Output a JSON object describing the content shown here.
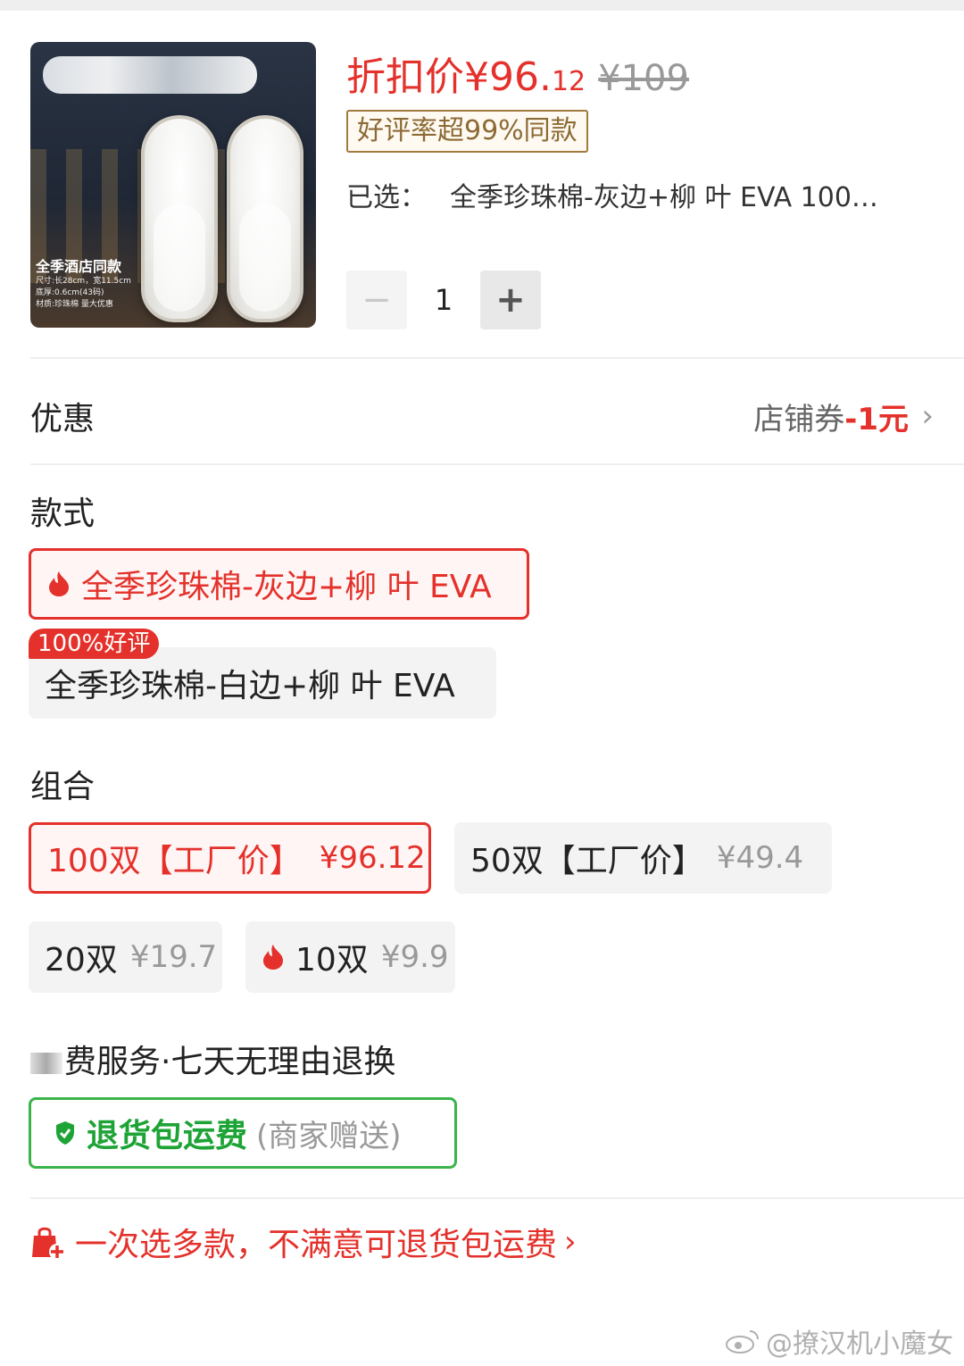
{
  "product": {
    "thumbnail_caption_title": "全季酒店同款",
    "thumbnail_caption_lines": [
      "尺寸:长28cm，宽11.5cm",
      "底厚:0.6cm(43码)",
      "材质:珍珠棉 量大优惠"
    ],
    "price_label": "折扣价",
    "price_main": "¥96.",
    "price_decimal": "12",
    "original_price": "¥109",
    "rating_badge": "好评率超99%同款",
    "selected_label": "已选：",
    "selected_value": "全季珍珠棉-灰边+柳 叶 EVA 100…",
    "quantity": "1",
    "minus_symbol": "−",
    "plus_symbol": "+"
  },
  "discount": {
    "label": "优惠",
    "value_prefix": "店铺券",
    "value_amount": "-1元",
    "chevron": "›"
  },
  "style_section": {
    "title": "款式",
    "options": [
      {
        "label": "全季珍珠棉-灰边+柳 叶 EVA",
        "selected": true,
        "hot": true
      },
      {
        "label": "全季珍珠棉-白边+柳 叶 EVA",
        "selected": false,
        "tag": "100%好评"
      }
    ]
  },
  "combo_section": {
    "title": "组合",
    "options": [
      {
        "label": "100双【工厂价】",
        "price": "¥96.12",
        "selected": true
      },
      {
        "label": "50双【工厂价】",
        "price": "¥49.4",
        "selected": false
      },
      {
        "label": "20双",
        "price": "¥19.7",
        "selected": false
      },
      {
        "label": "10双",
        "price": "¥9.9",
        "selected": false,
        "hot": true
      }
    ]
  },
  "service_section": {
    "title": "费服务·七天无理由退换",
    "return_label": "退货包运费",
    "return_note": "(商家赠送)"
  },
  "promo": {
    "text": "一次选多款，不满意可退货包运费",
    "chevron": "›"
  },
  "watermark": "@撩汉机小魔女",
  "colors": {
    "accent_red": "#e4312b",
    "badge_gold": "#a17a3e",
    "service_green": "#3bb54a",
    "muted_gray": "#999999"
  },
  "icons": [
    "flame-icon",
    "shield-check-icon",
    "shopping-bag-plus-icon",
    "chevron-right-icon",
    "weibo-logo-icon"
  ]
}
